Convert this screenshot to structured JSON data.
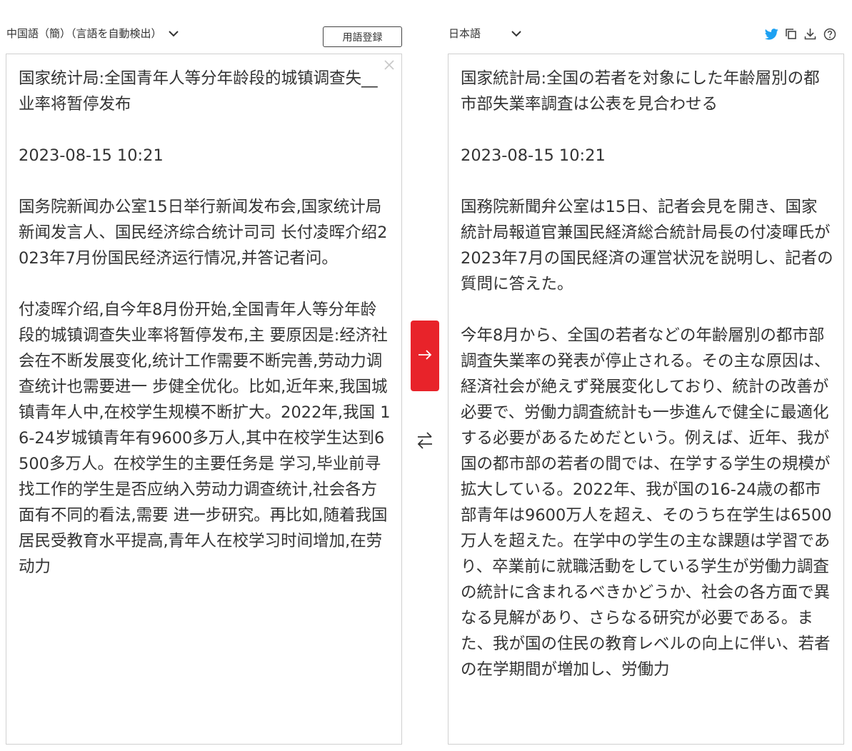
{
  "source": {
    "language": "中国語（簡）（言語を自動検出）",
    "glossary_button": "用語登録",
    "text": "国家统计局:全国青年人等分年龄段的城镇调查失__ 业率将暂停发布\n\n2023-08-15 10:21\n\n国务院新闻办公室15日举行新闻发布会,国家统计局新闻发言人、国民经济综合统计司司 长付凌晖介绍2023年7月份国民经济运行情况,并答记者问。\n\n付凌晖介绍,自今年8月份开始,全国青年人等分年龄段的城镇调查失业率将暂停发布,主 要原因是:经济社会在不断发展变化,统计工作需要不断完善,劳动力调查统计也需要进一 步健全优化。比如,近年来,我国城镇青年人中,在校学生规模不断扩大。2022年,我国 16-24岁城镇青年有9600多万人,其中在校学生达到6500多万人。在校学生的主要任务是 学习,毕业前寻找工作的学生是否应纳入劳动力调查统计,社会各方面有不同的看法,需要 进一步研究。再比如,随着我国居民受教育水平提高,青年人在校学习时间增加,在劳动力"
  },
  "target": {
    "language": "日本語",
    "text": "国家統計局:全国の若者を対象にした年齢層別の都市部失業率調査は公表を見合わせる\n\n2023-08-15 10:21\n\n国務院新聞弁公室は15日、記者会見を開き、国家統計局報道官兼国民経済総合統計局長の付凌暉氏が2023年7月の国民経済の運営状況を説明し、記者の質問に答えた。\n\n今年8月から、全国の若者などの年齢層別の都市部調査失業率の発表が停止される。その主な原因は、経済社会が絶えず発展変化しており、統計の改善が必要で、労働力調査統計も一歩進んで健全に最適化する必要があるためだという。例えば、近年、我が国の都市部の若者の間では、在学する学生の規模が拡大している。2022年、我が国の16-24歳の都市部青年は9600万人を超え、そのうち在学生は6500万人を超えた。在学中の学生の主な課題は学習であり、卒業前に就職活動をしている学生が労働力調査の統計に含まれるべきかどうか、社会の各方面で異なる見解があり、さらなる研究が必要である。また、我が国の住民の教育レベルの向上に伴い、若者の在学期間が増加し、労働力"
  },
  "icons": {
    "translate": "arrow-right-icon",
    "swap": "swap-icon",
    "clear": "close-icon",
    "twitter": "twitter-icon",
    "copy": "copy-icon",
    "download": "download-icon",
    "help": "help-icon"
  },
  "colors": {
    "accent": "#e8232a",
    "twitter": "#1da1f2",
    "border": "#d0d0d0",
    "text": "#333333"
  }
}
